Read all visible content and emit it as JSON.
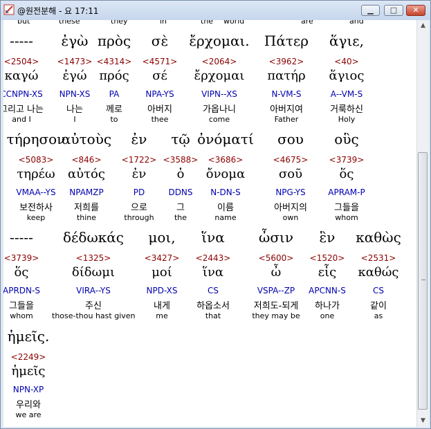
{
  "window": {
    "title": "@원전분해 - 요 17:11"
  },
  "top_partial": [
    "but",
    "these",
    "they",
    "in",
    "the",
    "world",
    "are",
    "and"
  ],
  "rows": [
    [
      {
        "greek": "-----",
        "strong": "<2504>",
        "lemma": "καγώ",
        "parse": "CCNPN-XS",
        "korean": "그리고 나는",
        "english": "and I"
      },
      {
        "greek": "ἐγὼ",
        "strong": "<1473>",
        "lemma": "ἐγώ",
        "parse": "NPN-XS",
        "korean": "나는",
        "english": "I"
      },
      {
        "greek": "πρὸς",
        "strong": "<4314>",
        "lemma": "πρός",
        "parse": "PA",
        "korean": "께로",
        "english": "to"
      },
      {
        "greek": "σὲ",
        "strong": "<4571>",
        "lemma": "σέ",
        "parse": "NPA-YS",
        "korean": "아버지",
        "english": "thee"
      },
      {
        "greek": "ἔρχομαι.",
        "strong": "<2064>",
        "lemma": "ἔρχομαι",
        "parse": "VIPN--XS",
        "korean": "가옵나니",
        "english": "come"
      },
      {
        "greek": "Πάτερ",
        "strong": "<3962>",
        "lemma": "πατήρ",
        "parse": "N-VM-S",
        "korean": "아버지여",
        "english": "Father"
      },
      {
        "greek": "ἅγιε,",
        "strong": "<40>",
        "lemma": "ἅγιος",
        "parse": "A--VM-S",
        "korean": "거룩하신",
        "english": "Holy"
      }
    ],
    [
      {
        "greek": "τήρησον",
        "strong": "<5083>",
        "lemma": "τηρέω",
        "parse": "VMAA--YS",
        "korean": "보전하사",
        "english": "keep"
      },
      {
        "greek": "αὐτοὺς",
        "strong": "<846>",
        "lemma": "αὐτός",
        "parse": "NPAMZP",
        "korean": "저희를",
        "english": "thine"
      },
      {
        "greek": "ἐν",
        "strong": "<1722>",
        "lemma": "ἐν",
        "parse": "PD",
        "korean": "으로",
        "english": "through"
      },
      {
        "greek": "τῷ",
        "strong": "<3588>",
        "lemma": "ὁ",
        "parse": "DDNS",
        "korean": "그",
        "english": "the"
      },
      {
        "greek": "ὀνόματί",
        "strong": "<3686>",
        "lemma": "ὄνομα",
        "parse": "N-DN-S",
        "korean": "이름",
        "english": "name"
      },
      {
        "greek": "σου",
        "strong": "<4675>",
        "lemma": "σοῦ",
        "parse": "NPG-YS",
        "korean": "아버지의",
        "english": "own"
      },
      {
        "greek": "οὓς",
        "strong": "<3739>",
        "lemma": "ὅς",
        "parse": "APRAM-P",
        "korean": "그들을",
        "english": "whom"
      }
    ],
    [
      {
        "greek": "-----",
        "strong": "<3739>",
        "lemma": "ὅς",
        "parse": "APRDN-S",
        "korean": "그들을",
        "english": "whom"
      },
      {
        "greek": "δέδωκάς",
        "strong": "<1325>",
        "lemma": "δίδωμι",
        "parse": "VIRA--YS",
        "korean": "주신",
        "english": "those-thou hast given"
      },
      {
        "greek": "μοι,",
        "strong": "<3427>",
        "lemma": "μοί",
        "parse": "NPD-XS",
        "korean": "내게",
        "english": "me"
      },
      {
        "greek": "ἵνα",
        "strong": "<2443>",
        "lemma": "ἵνα",
        "parse": "CS",
        "korean": "하옵소서",
        "english": "that"
      },
      {
        "greek": "ὦσιν",
        "strong": "<5600>",
        "lemma": "ὦ",
        "parse": "VSPA--ZP",
        "korean": "저희도-되게",
        "english": "they may be"
      },
      {
        "greek": "ἓν",
        "strong": "<1520>",
        "lemma": "εἷς",
        "parse": "APCNN-S",
        "korean": "하나가",
        "english": "one"
      },
      {
        "greek": "καθὼς",
        "strong": "<2531>",
        "lemma": "καθώς",
        "parse": "CS",
        "korean": "같이",
        "english": "as"
      }
    ],
    [
      {
        "greek": "ἡμεῖς.",
        "strong": "<2249>",
        "lemma": "ἡμεῖς",
        "parse": "NPN-XP",
        "korean": "우리와",
        "english": "we are"
      }
    ]
  ]
}
